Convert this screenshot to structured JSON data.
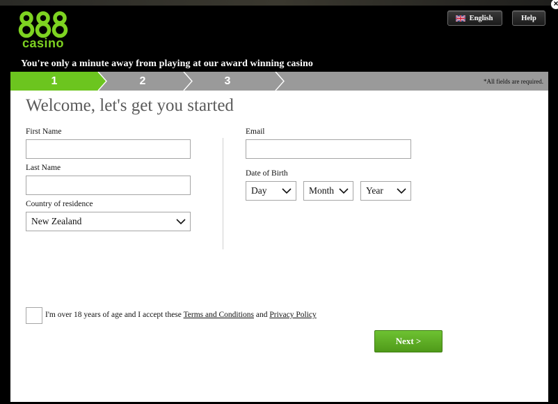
{
  "window": {
    "close_icon": "close-icon",
    "close_glyph": "×"
  },
  "header": {
    "logo_text": "888",
    "logo_subtext": "casino",
    "language_label": "English",
    "help_label": "Help",
    "tagline": "You're only a minute away from playing at our award winning casino"
  },
  "progress": {
    "steps": [
      "1",
      "2",
      "3"
    ],
    "active_step": 1,
    "required_note": "*All fields are required."
  },
  "form": {
    "heading": "Welcome, let's get you started",
    "first_name": {
      "label": "First Name",
      "value": "",
      "placeholder": ""
    },
    "last_name": {
      "label": "Last Name",
      "value": "",
      "placeholder": ""
    },
    "country": {
      "label": "Country of residence",
      "selected": "New Zealand"
    },
    "email": {
      "label": "Email",
      "value": "",
      "placeholder": ""
    },
    "dob": {
      "label": "Date of Birth",
      "day": "Day",
      "month": "Month",
      "year": "Year"
    },
    "consent": {
      "checked": false,
      "text_before": "I'm over 18 years of age and I accept these ",
      "terms_link": "Terms and Conditions",
      "text_middle": " and ",
      "privacy_link": "Privacy Policy"
    },
    "next_label": "Next >"
  },
  "colors": {
    "brand_green": "#7ed321",
    "active_step_green": "#6cc51f",
    "inactive_step_gray": "#9a9a9a",
    "button_green": "#5bab23",
    "background": "#000000",
    "panel": "#ffffff"
  }
}
